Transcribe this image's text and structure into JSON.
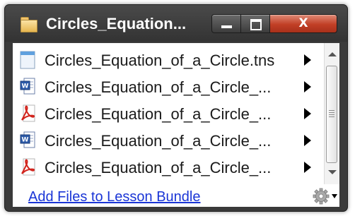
{
  "window": {
    "title": "Circles_Equation...",
    "close_label": "X"
  },
  "files": [
    {
      "name": "Circles_Equation_of_a_Circle.tns",
      "icon": "tns-file-icon"
    },
    {
      "name": "Circles_Equation_of_a_Circle_...",
      "icon": "word-document-icon"
    },
    {
      "name": "Circles_Equation_of_a_Circle_...",
      "icon": "pdf-icon"
    },
    {
      "name": "Circles_Equation_of_a_Circle_...",
      "icon": "word-document-icon"
    },
    {
      "name": "Circles_Equation_of_a_Circle_...",
      "icon": "pdf-icon"
    }
  ],
  "footer": {
    "add_files_label": "Add Files to Lesson Bundle"
  },
  "colors": {
    "titlebar": "#3a3a3a",
    "close_button": "#c13f26",
    "link": "#1a35d6"
  }
}
